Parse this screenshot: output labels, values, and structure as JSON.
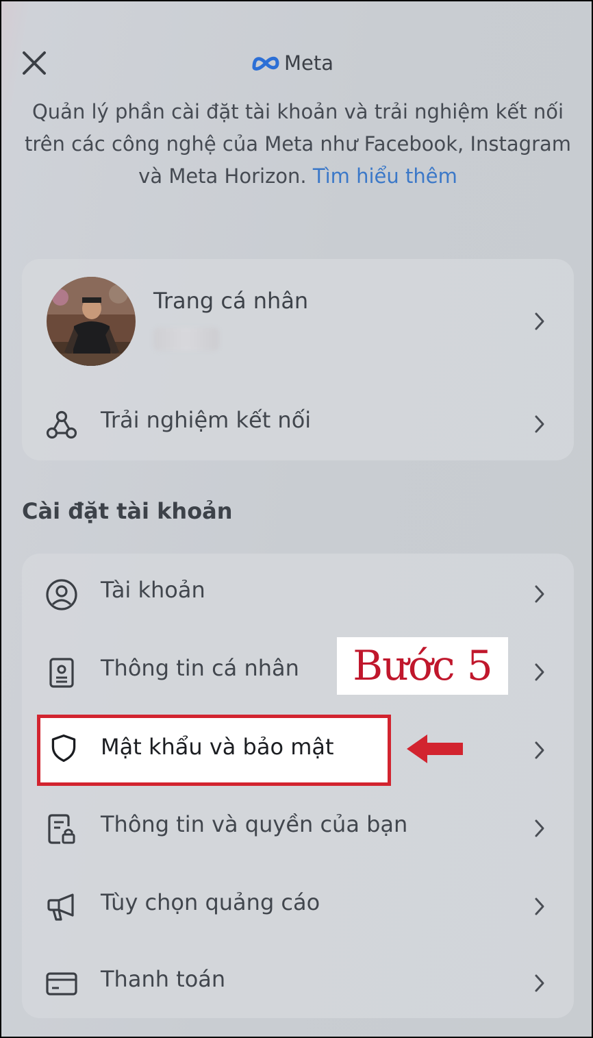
{
  "header": {
    "brand": "Meta"
  },
  "intro": {
    "text": "Quản lý phần cài đặt tài khoản và trải nghiệm kết nối trên các công nghệ của Meta như Facebook, Instagram và Meta Horizon.",
    "link": "Tìm hiểu thêm"
  },
  "profile_card": {
    "title": "Trang cá nhân",
    "connected_label": "Trải nghiệm kết nối"
  },
  "section": {
    "title": "Cài đặt tài khoản"
  },
  "settings": [
    {
      "label": "Tài khoản",
      "icon": "user-circle-icon"
    },
    {
      "label": "Thông tin cá nhân",
      "icon": "id-card-icon"
    },
    {
      "label": "Mật khẩu và bảo mật",
      "icon": "shield-icon"
    },
    {
      "label": "Thông tin và quyền của bạn",
      "icon": "document-lock-icon"
    },
    {
      "label": "Tùy chọn quảng cáo",
      "icon": "megaphone-icon"
    },
    {
      "label": "Thanh toán",
      "icon": "credit-card-icon"
    }
  ],
  "annotation": {
    "step": "Bước 5",
    "color": "#d2242f"
  },
  "colors": {
    "link": "#3b78c8",
    "meta_blue": "#2c6fd6"
  }
}
